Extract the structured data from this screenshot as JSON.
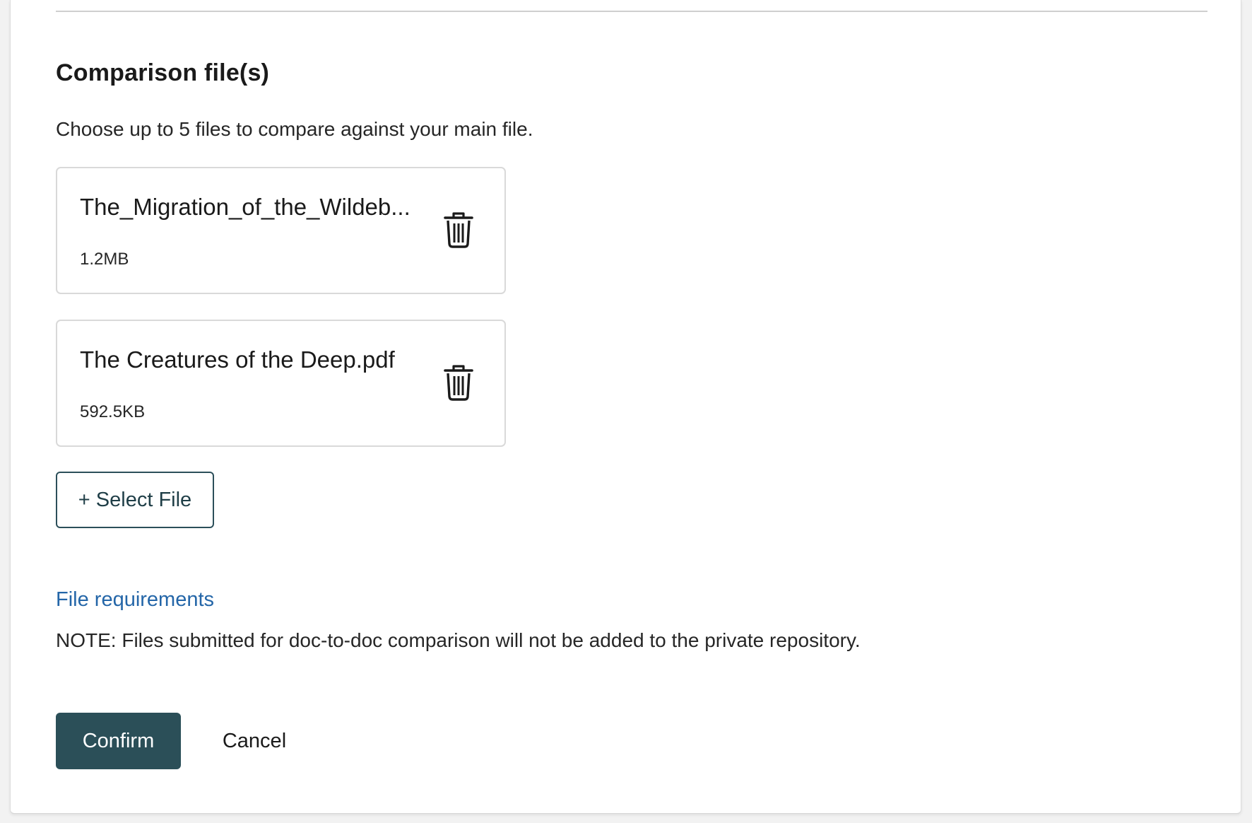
{
  "section": {
    "title": "Comparison file(s)",
    "description": "Choose up to 5 files to compare against your main file."
  },
  "files": [
    {
      "name": "The_Migration_of_the_Wildebeest.pdf",
      "display_name": "The_Migration_of_the_Wildeb...",
      "size": "1.2MB",
      "action_icon": "trash-icon"
    },
    {
      "name": "The Creatures of the Deep.pdf",
      "display_name": "The Creatures of the Deep.pdf",
      "size": "592.5KB",
      "action_icon": "trash-icon"
    }
  ],
  "select_file_label": "+ Select File",
  "file_requirements_link": "File requirements",
  "note": "NOTE: Files submitted for doc-to-doc comparison will not be added to the private repository.",
  "actions": {
    "confirm_label": "Confirm",
    "cancel_label": "Cancel"
  },
  "colors": {
    "primary_button": "#2b4f58",
    "link": "#2466a8",
    "card_border": "#d9d9d9"
  }
}
